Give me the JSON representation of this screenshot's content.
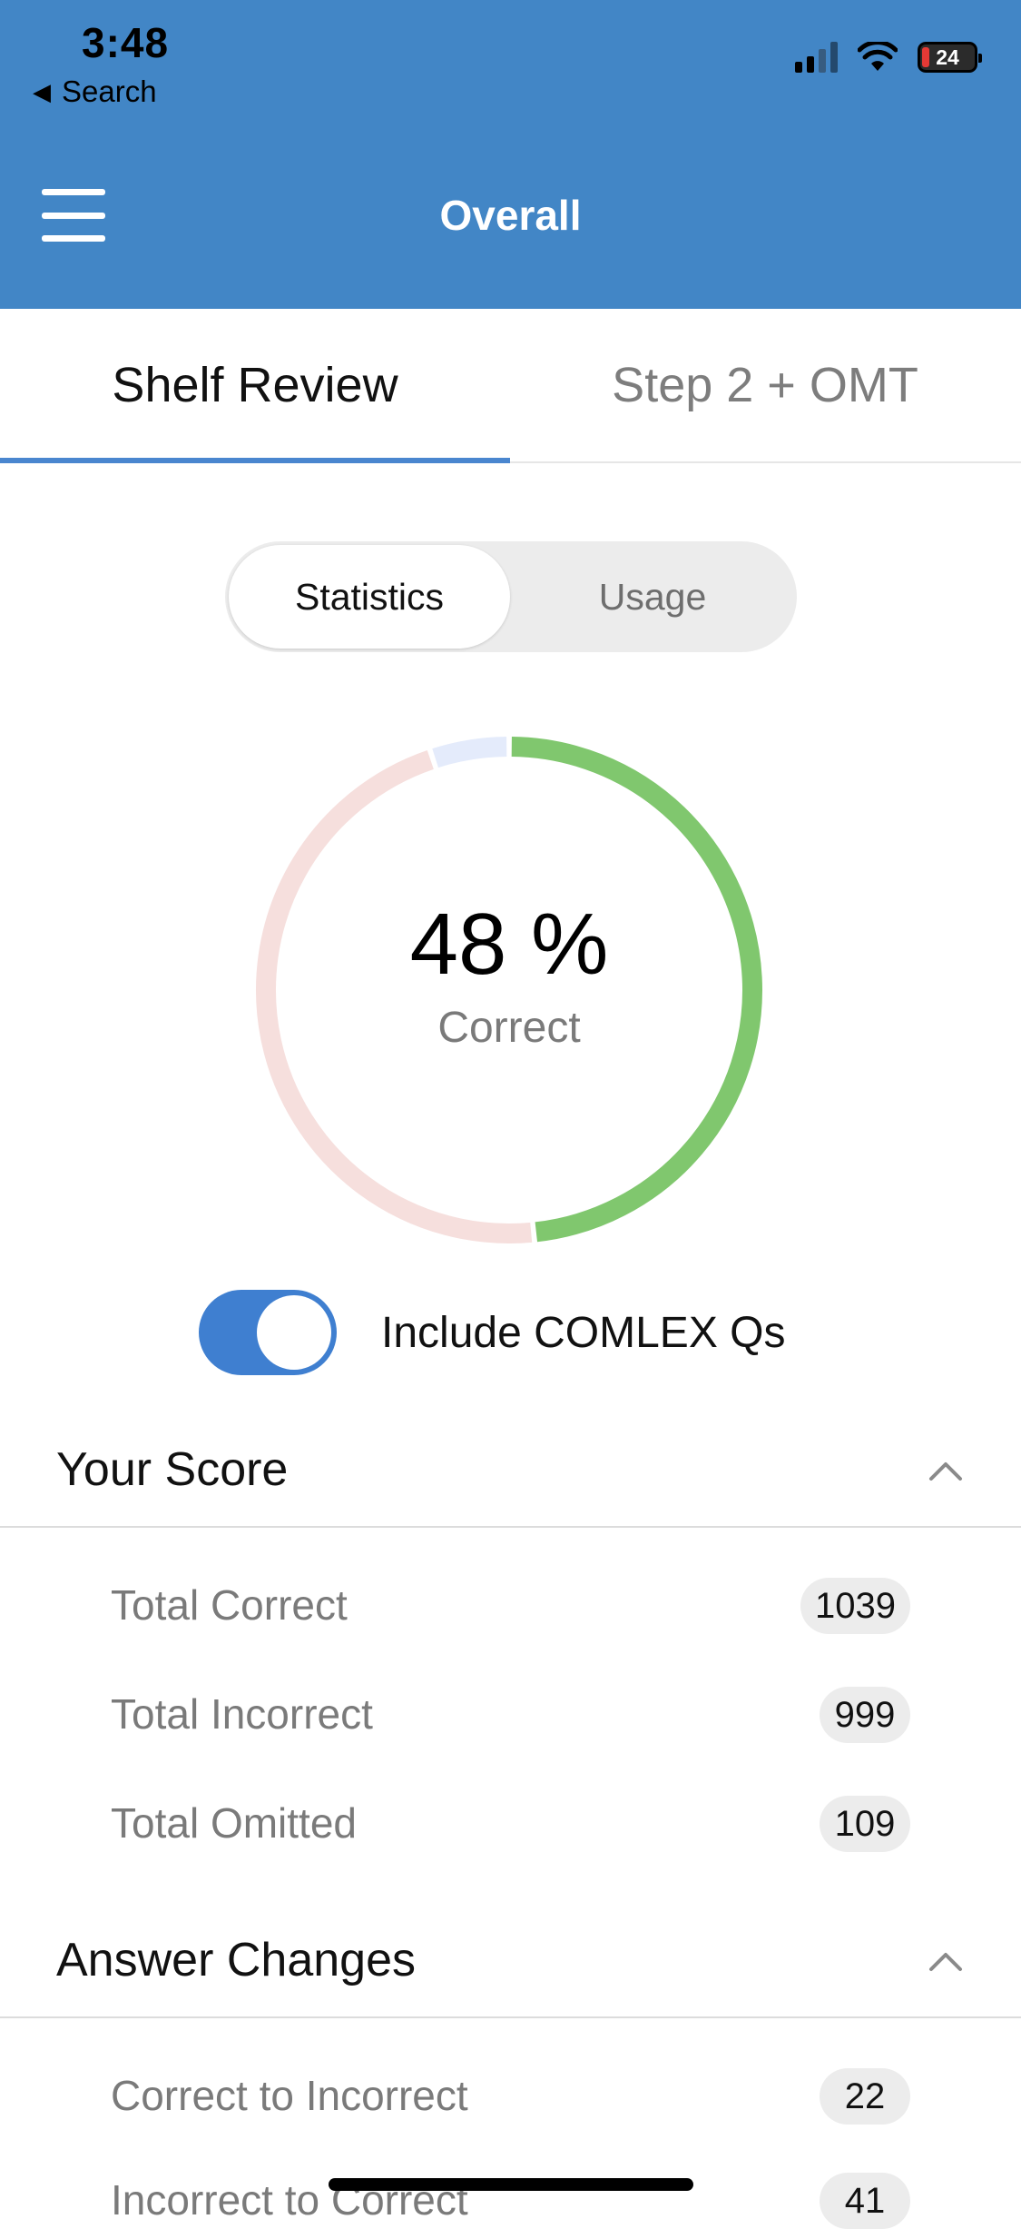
{
  "status_bar": {
    "time": "3:48",
    "back_label": "Search",
    "battery_level": "24"
  },
  "header": {
    "title": "Overall"
  },
  "tabs": [
    {
      "label": "Shelf Review",
      "active": true
    },
    {
      "label": "Step 2 + OMT",
      "active": false
    }
  ],
  "segmented": {
    "statistics_label": "Statistics",
    "usage_label": "Usage",
    "selected": "Statistics"
  },
  "donut": {
    "percent_text": "48 %",
    "label": "Correct",
    "segments": [
      {
        "name": "correct",
        "value": 1039,
        "color": "#80c76e"
      },
      {
        "name": "incorrect",
        "value": 999,
        "color": "#f6dfdd"
      },
      {
        "name": "omitted",
        "value": 109,
        "color": "#e4ebfb"
      }
    ]
  },
  "toggle": {
    "label": "Include COMLEX Qs",
    "on": true
  },
  "your_score": {
    "title": "Your Score",
    "rows": [
      {
        "label": "Total Correct",
        "value": "1039"
      },
      {
        "label": "Total Incorrect",
        "value": "999"
      },
      {
        "label": "Total Omitted",
        "value": "109"
      }
    ]
  },
  "answer_changes": {
    "title": "Answer Changes",
    "rows": [
      {
        "label": "Correct to Incorrect",
        "value": "22"
      },
      {
        "label": "Incorrect to Correct",
        "value": "41"
      }
    ]
  },
  "colors": {
    "header_bg": "#4286c6",
    "accent": "#4a86cf",
    "toggle_on": "#3f7fd0"
  }
}
